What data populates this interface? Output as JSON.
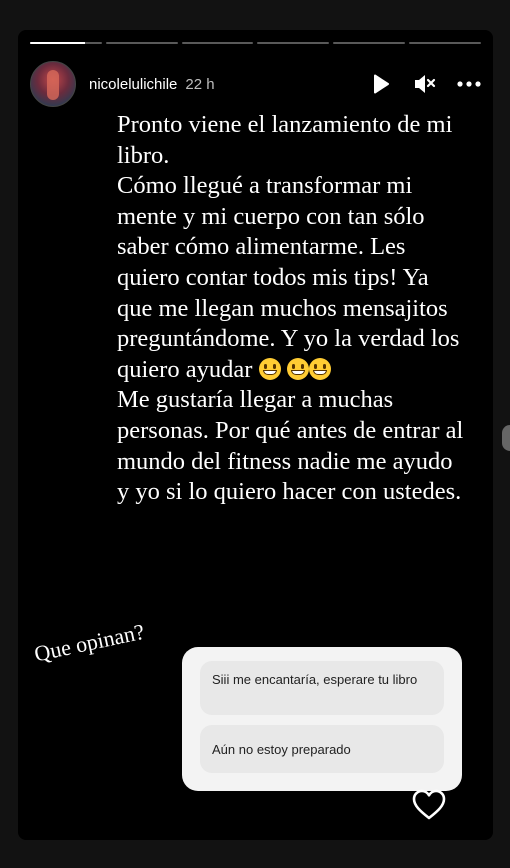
{
  "story": {
    "progress_segments": [
      0.77,
      0,
      0,
      0,
      0,
      0
    ],
    "user": {
      "username": "nicolelulichile",
      "time": "22 h"
    },
    "header_icons": [
      "play-icon",
      "mute-icon",
      "more-icon"
    ],
    "text_paragraphs": [
      "Pronto viene el lanzamiento de mi libro.",
      "Cómo llegué a transformar mi mente y mi cuerpo con tan sólo saber cómo alimentarme. Les quiero contar todos mis tips! Ya que me llegan muchos mensajitos preguntándome. Y yo la verdad los quiero ayudar",
      "Me gustaría llegar a muchas personas. Por qué antes de entrar al mundo del fitness nadie me ayudo y yo si lo quiero hacer con ustedes."
    ],
    "emoji": "grinning-face",
    "question": "Que opinan?",
    "poll": {
      "options": [
        "Siii me encantaría, esperare tu libro",
        "Aún no estoy preparado"
      ]
    },
    "like_icon": "heart-icon"
  }
}
